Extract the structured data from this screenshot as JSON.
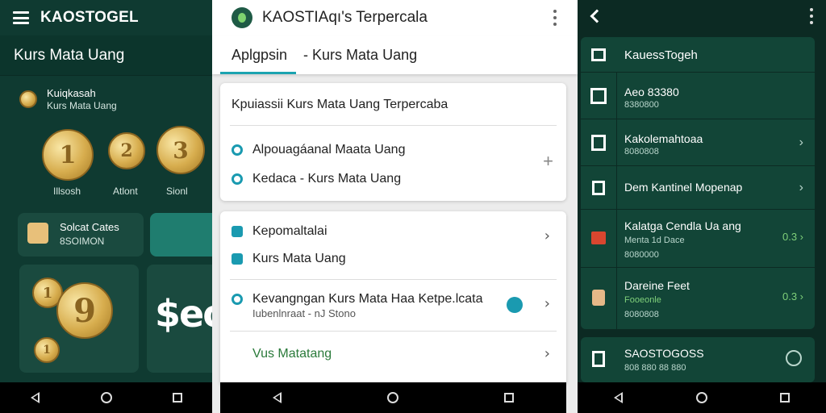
{
  "left": {
    "brand": "KAOSTOGEL",
    "subtitle": "Kurs Mata Uang",
    "header_card": {
      "title": "Kuiqkasah",
      "subtitle": "Kurs Mata Uang"
    },
    "coins": [
      {
        "glyph": "1",
        "label": "Illsosh"
      },
      {
        "glyph": "2",
        "label": "Atlont"
      },
      {
        "glyph": "3",
        "label": "Sionl"
      }
    ],
    "card_a": {
      "title": "Solcat Cates",
      "subtitle": "8SOIMON"
    },
    "big_coin_glyph": "9",
    "small_coin_glyphs": [
      "1",
      "1"
    ],
    "big_text": "$eo"
  },
  "middle": {
    "title": "KAOSTIAqı's Terpercala",
    "tabs": [
      "Aplgpsin",
      "- Kurs Mata Uang"
    ],
    "card1": {
      "title": "Kpuiassii Kurs Mata Uang Terpercaba",
      "rows": [
        "Alpouagáanal Maata Uang",
        "Kedaca - Kurs Mata Uang"
      ],
      "plus": "+"
    },
    "card2": {
      "rows": [
        {
          "label": "Kepomaltalai",
          "chevron": "›"
        },
        {
          "label": "Kurs Mata Uang"
        },
        {
          "label": "Kevangngan Kurs Mata Haa Ketpe.lcata",
          "sub": "Iubenlnraat - nJ Stono",
          "chevron": "›"
        },
        {
          "label": "Vus Matatang",
          "chevron": "›"
        }
      ]
    }
  },
  "right": {
    "header": "KauessTogeh",
    "rows": [
      {
        "title": "Aeo 83380",
        "sub": "8380800",
        "chevron": ""
      },
      {
        "title": "Kakolemahtoaa",
        "sub": "8080808",
        "chevron": "›"
      },
      {
        "title": "Dem Kantinel Mopenap",
        "sub": "",
        "chevron": "›"
      },
      {
        "title": "Kalatga Cendla Ua ang",
        "sub": "Menta 1d Dace",
        "sub2": "8080000",
        "value": "0.3 ›"
      },
      {
        "title": "Dareine Feet",
        "sub": "Fooeonle",
        "sub2": "8080808",
        "value": "0.3 ›"
      }
    ],
    "footer": {
      "title": "SAOSTOGOSS",
      "sub": "808 880 88 880"
    }
  },
  "navbar": {
    "back": "back",
    "home": "home",
    "recents": "recents"
  },
  "colors": {
    "accent": "#1a9ab0",
    "dark_green": "#0f3a31",
    "gold": "#d7ad4e",
    "value_green": "#7fd07a"
  }
}
